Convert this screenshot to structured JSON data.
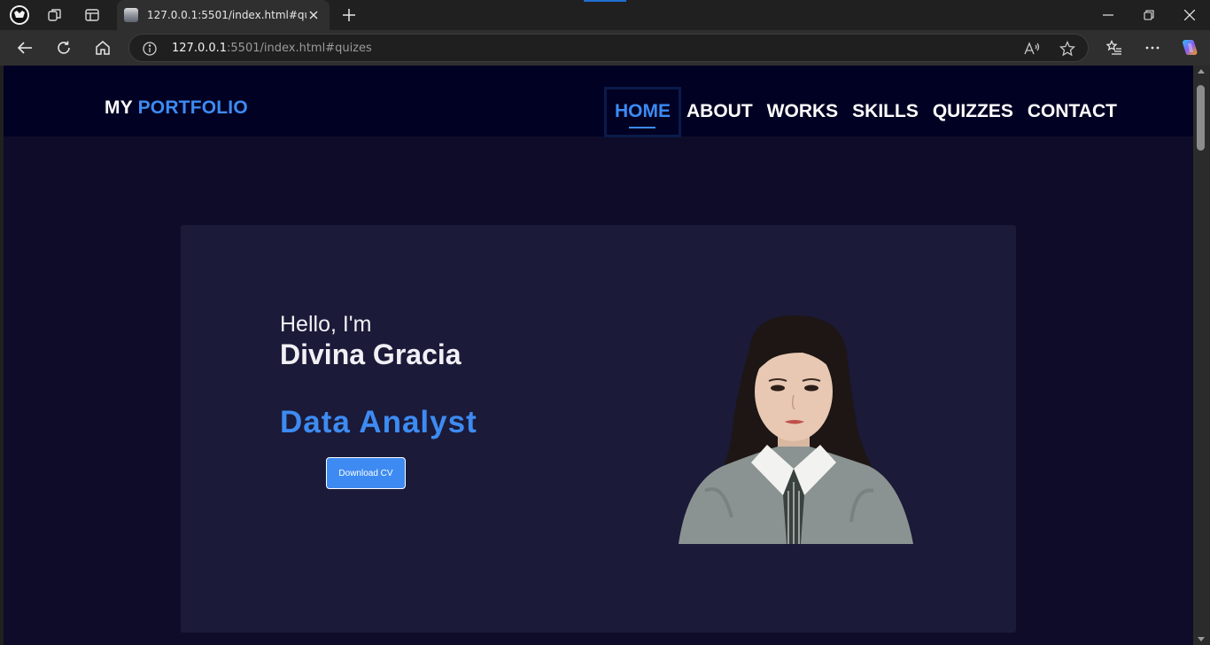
{
  "browser": {
    "tab_title": "127.0.0.1:5501/index.html#quizes",
    "url_host": "127.0.0.1",
    "url_rest": ":5501/index.html#quizes"
  },
  "site": {
    "logo_prefix": "MY",
    "logo_accent": "PORTFOLIO",
    "nav": [
      "HOME",
      "ABOUT",
      "WORKS",
      "SKILLS",
      "QUIZZES",
      "CONTACT"
    ],
    "active_nav": "HOME"
  },
  "hero": {
    "greeting": "Hello, I'm",
    "name": "Divina Gracia",
    "role": "Data Analyst",
    "cv_button": "Download CV"
  },
  "colors": {
    "page_bg": "#0e0c29",
    "header_bg": "#010124",
    "card_bg": "#1b1a38",
    "accent": "#3d8bf2"
  }
}
